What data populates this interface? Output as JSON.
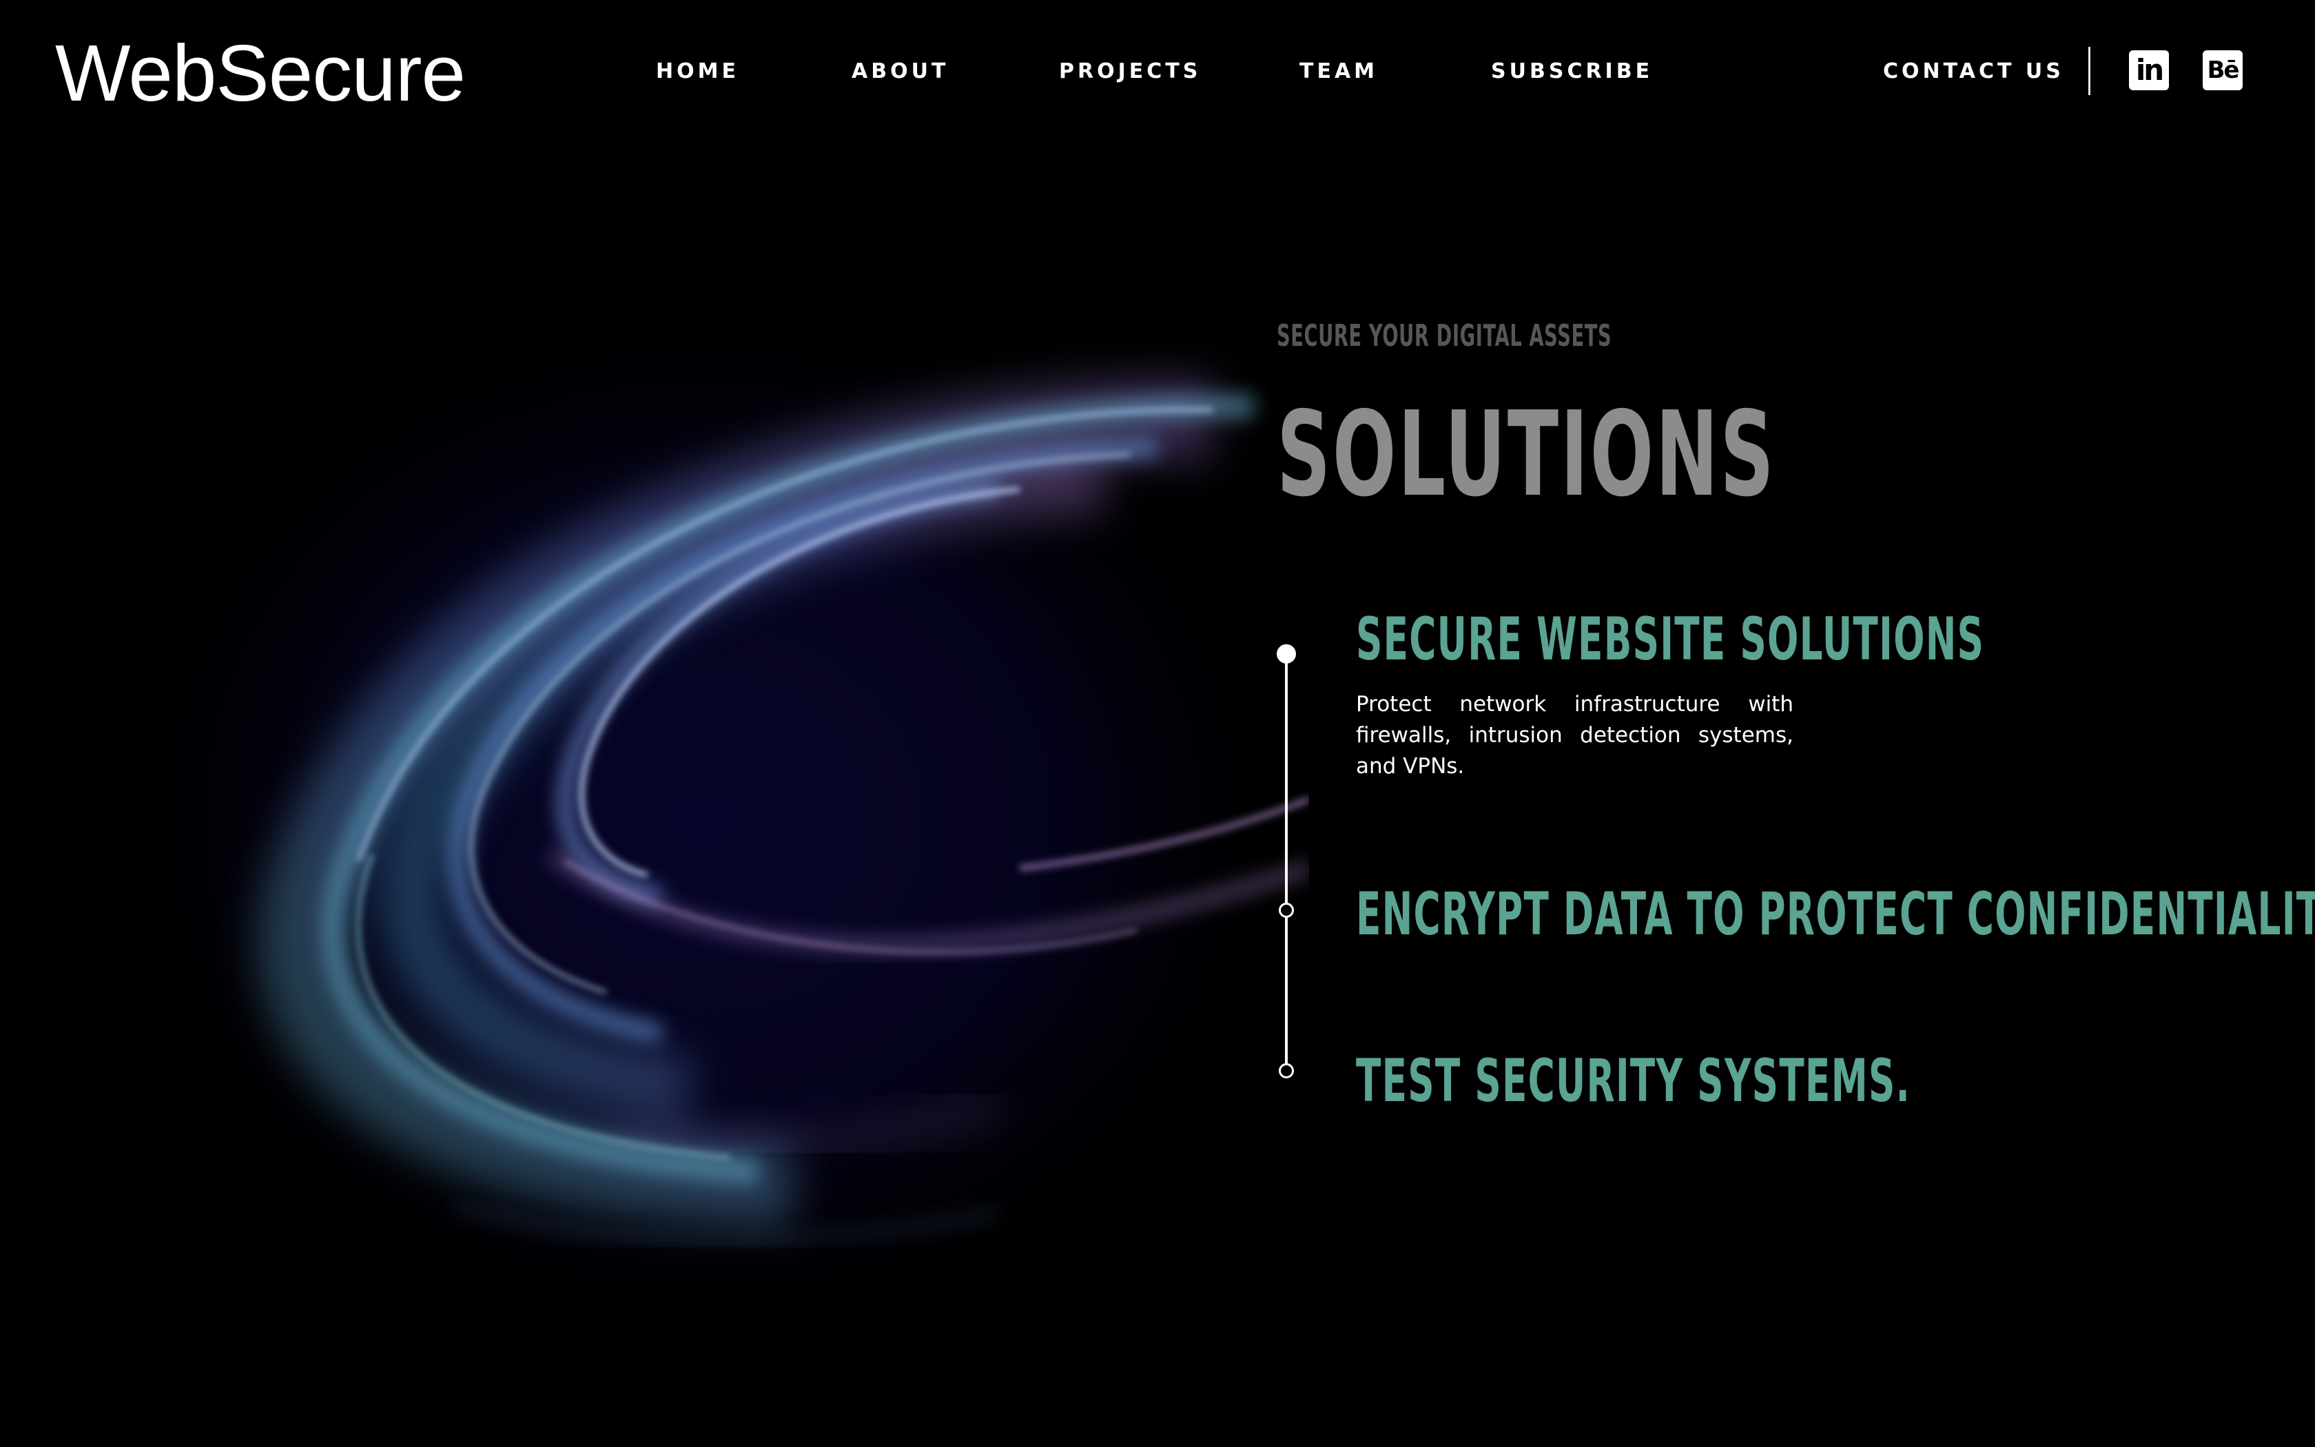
{
  "brand": {
    "logo": "WebSecure"
  },
  "nav": {
    "home": "HOME",
    "about": "ABOUT",
    "projects": "PROJECTS",
    "team": "TEAM",
    "subscribe": "SUBSCRIBE",
    "contact": "CONTACT US"
  },
  "social": {
    "linkedin": {
      "icon": "linkedin-icon",
      "glyph": "in"
    },
    "behance": {
      "icon": "behance-icon",
      "glyph": "Bē"
    }
  },
  "hero": {
    "eyebrow": "SECURE YOUR DIGITAL ASSETS",
    "title": "SOLUTIONS"
  },
  "solutions": [
    {
      "heading": "SECURE WEBSITE SOLUTIONS",
      "description": "Protect network infrastructure with firewalls, intrusion detection systems, and VPNs."
    },
    {
      "heading": "ENCRYPT DATA TO PROTECT CONFIDENTIALITY."
    },
    {
      "heading": "TEST SECURITY SYSTEMS."
    }
  ],
  "colors": {
    "background": "#000000",
    "accent": "#5ba392",
    "title_gray": "#8c8c8c",
    "eyebrow_gray": "#575757",
    "text": "#ffffff"
  }
}
